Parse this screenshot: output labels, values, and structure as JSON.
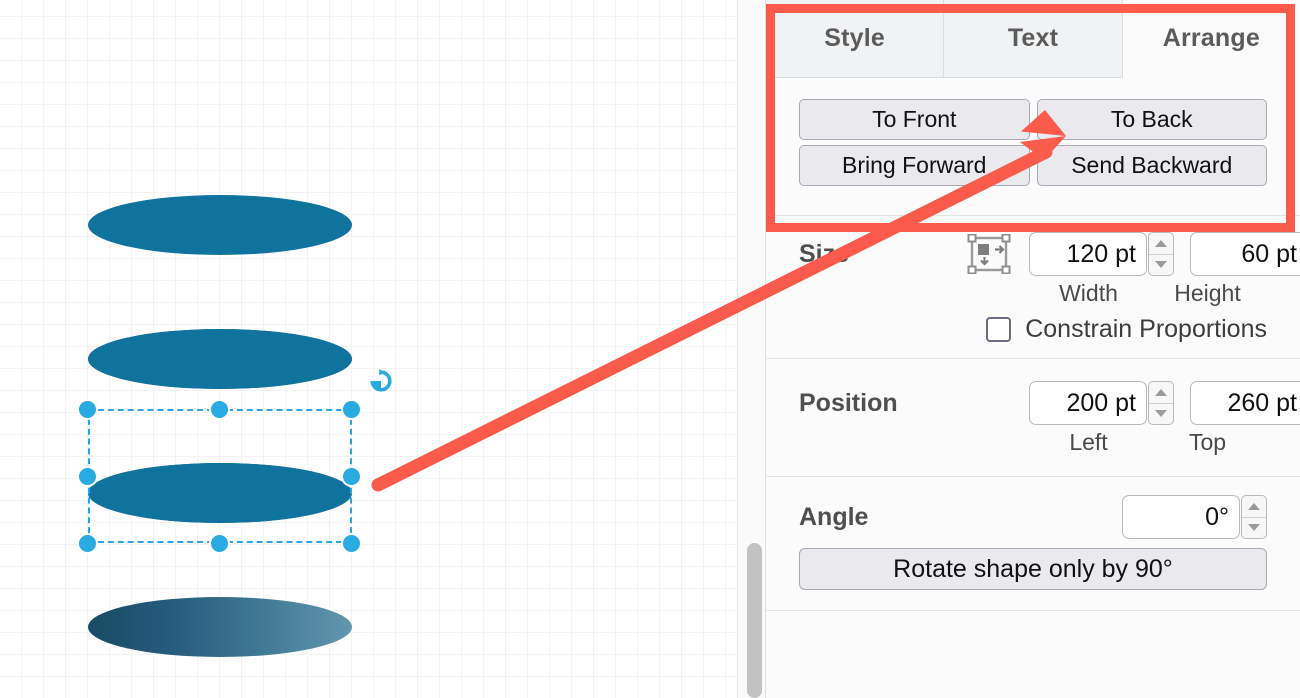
{
  "app": {
    "canvas_label": "diagram-canvas",
    "grid_minor_color": "#f3f3f3",
    "grid_major_color": "#e3e3e3",
    "highlight_color": "#fb5b4b",
    "accent_color": "#29abe2"
  },
  "shape": {
    "type": "cylinder-stack",
    "count": 3,
    "fill_top": "#10739e",
    "fill_body_dark": "#1b4a63",
    "fill_body_light": "#6296ae",
    "selected_index": 2
  },
  "panel": {
    "tabs": [
      {
        "label": "Style",
        "active": false
      },
      {
        "label": "Text",
        "active": false
      },
      {
        "label": "Arrange",
        "active": true
      }
    ],
    "arrange": {
      "to_front": "To Front",
      "to_back": "To Back",
      "bring_forward": "Bring Forward",
      "send_backward": "Send Backward"
    },
    "size": {
      "label": "Size",
      "icon": "autosize-icon",
      "width_value": "120 pt",
      "height_value": "60 pt",
      "width_label": "Width",
      "height_label": "Height",
      "constrain_label": "Constrain Proportions",
      "constrain_checked": false
    },
    "position": {
      "label": "Position",
      "left_value": "200 pt",
      "top_value": "260 pt",
      "left_label": "Left",
      "top_label": "Top"
    },
    "angle": {
      "label": "Angle",
      "value": "0°",
      "rotate_button": "Rotate shape only by 90°"
    }
  },
  "annotation": {
    "kind": "red-arrow",
    "points_to": "To Back",
    "color": "#fb5b4b"
  }
}
